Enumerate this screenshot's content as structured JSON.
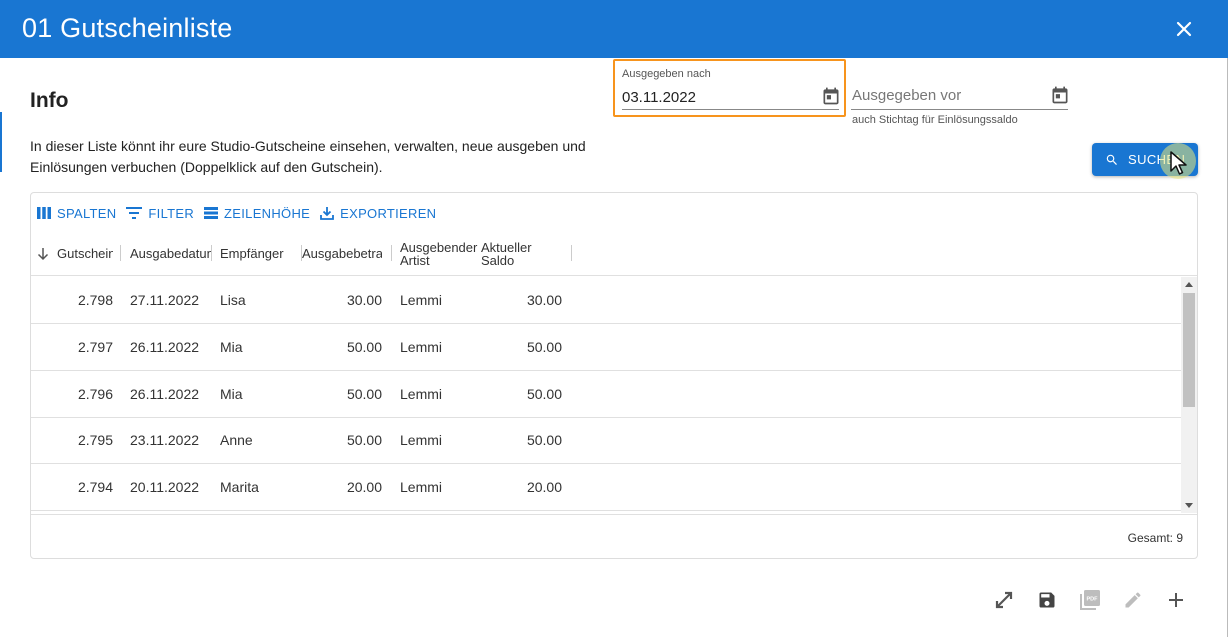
{
  "dialog": {
    "title": "01 Gutscheinliste",
    "close_icon": "close-icon"
  },
  "info": {
    "heading": "Info",
    "text": "In dieser Liste könnt ihr eure Studio-Gutscheine einsehen, verwalten, neue ausgeben und Einlösungen verbuchen (Doppelklick auf den Gutschein)."
  },
  "filters": {
    "issued_after": {
      "label": "Ausgegeben nach",
      "value": "03.11.2022",
      "icon": "calendar-icon"
    },
    "issued_before": {
      "placeholder": "Ausgegeben vor",
      "value": "",
      "icon": "calendar-icon",
      "helper": "auch Stichtag für Einlösungssaldo"
    },
    "search_label": "SUCHEN"
  },
  "toolbar": {
    "columns": "SPALTEN",
    "filter": "FILTER",
    "density": "ZEILENHÖHE",
    "export": "EXPORTIEREN"
  },
  "table": {
    "columns": [
      "Gutschein",
      "Ausgabedatum",
      "Empfänger",
      "Ausgabebetrag",
      "Ausgebender Artist",
      "Aktueller Saldo"
    ],
    "sort": {
      "column": "Gutschein",
      "direction": "descending"
    },
    "rows": [
      {
        "id": "2.798",
        "date": "27.11.2022",
        "recipient": "Lisa",
        "amount": "30.00",
        "artist": "Lemmi",
        "balance": "30.00"
      },
      {
        "id": "2.797",
        "date": "26.11.2022",
        "recipient": "Mia",
        "amount": "50.00",
        "artist": "Lemmi",
        "balance": "50.00"
      },
      {
        "id": "2.796",
        "date": "26.11.2022",
        "recipient": "Mia",
        "amount": "50.00",
        "artist": "Lemmi",
        "balance": "50.00"
      },
      {
        "id": "2.795",
        "date": "23.11.2022",
        "recipient": "Anne",
        "amount": "50.00",
        "artist": "Lemmi",
        "balance": "50.00"
      },
      {
        "id": "2.794",
        "date": "20.11.2022",
        "recipient": "Marita",
        "amount": "20.00",
        "artist": "Lemmi",
        "balance": "20.00"
      }
    ],
    "total": "Gesamt: 9"
  },
  "actions": [
    "fullscreen-icon",
    "save-icon",
    "pdf-icon",
    "edit-icon",
    "add-icon"
  ],
  "colors": {
    "primary": "#1976d2",
    "focus_outline": "#f7941d"
  }
}
